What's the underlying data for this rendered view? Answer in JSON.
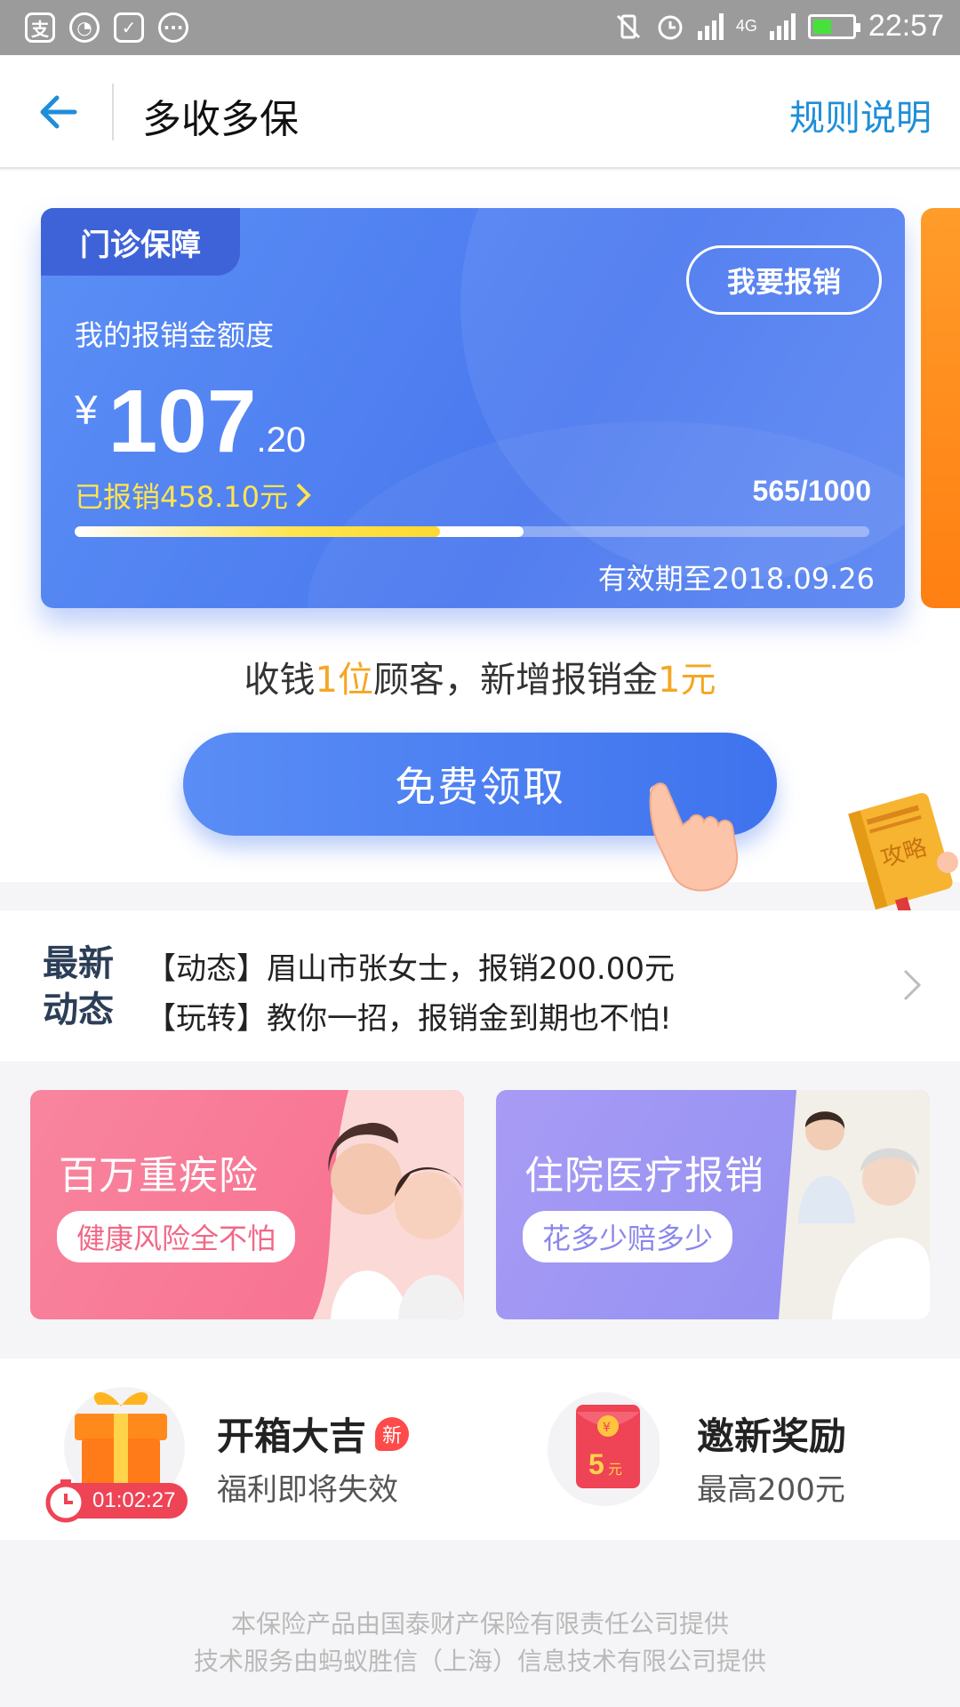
{
  "status_bar": {
    "time": "22:57",
    "network": "4G",
    "left_icons": [
      "alipay-icon",
      "wechat-icon",
      "shield-icon",
      "more-dots-icon"
    ],
    "right_icons": [
      "vibrate-off-icon",
      "alarm-icon",
      "signal-icon",
      "signal-4g-icon",
      "battery-icon"
    ]
  },
  "header": {
    "title": "多收多保",
    "rules_link": "规则说明"
  },
  "card": {
    "tag": "门诊保障",
    "claim_button": "我要报销",
    "quota_label": "我的报销金额度",
    "currency": "¥",
    "amount_int": "107",
    "amount_dec": ".20",
    "reimbursed": "已报销458.10元",
    "progress_text": "565/1000",
    "progress_value": 565,
    "progress_max": 1000,
    "progress_yellow_fraction": 0.46,
    "valid_until": "有效期至2018.09.26",
    "accent": "#4a78ef",
    "highlight": "#ffe44f"
  },
  "promo": {
    "part1": "收钱",
    "num1": "1位",
    "part2": "顾客，新增报销金",
    "num2": "1元"
  },
  "free_button": "免费领取",
  "guide_book_label": "攻略",
  "news": {
    "badge_line1": "最新",
    "badge_line2": "动态",
    "line1": "【动态】眉山市张女士，报销200.00元",
    "line2": "【玩转】教你一招，报销金到期也不怕!"
  },
  "banners": [
    {
      "title": "百万重疾险",
      "subtitle": "健康风险全不怕",
      "color": "#f77a95"
    },
    {
      "title": "住院医疗报销",
      "subtitle": "花多少赔多少",
      "color": "#9d95f3"
    }
  ],
  "features": [
    {
      "title": "开箱大吉",
      "badge": "新",
      "subtitle": "福利即将失效",
      "timer": "01:02:27"
    },
    {
      "title": "邀新奖励",
      "subtitle": "最高200元",
      "redpack_amount": "5",
      "redpack_unit": "元",
      "redpack_symbol": "¥"
    }
  ],
  "footer": {
    "line1": "本保险产品由国泰财产保险有限责任公司提供",
    "line2": "技术服务由蚂蚁胜信（上海）信息技术有限公司提供"
  }
}
